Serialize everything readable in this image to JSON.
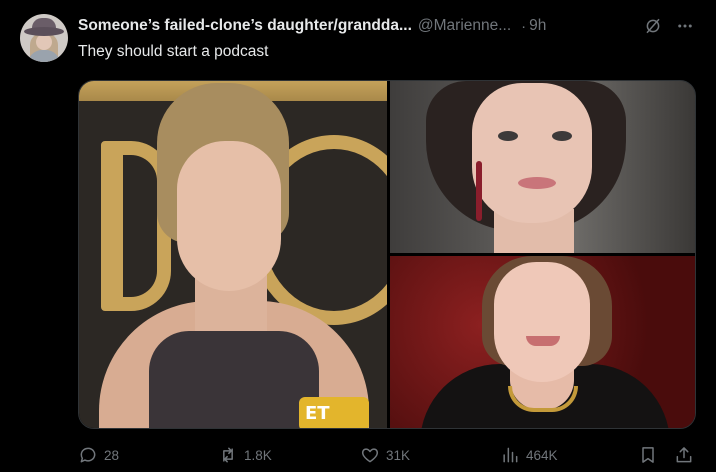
{
  "author": {
    "display_name": "Someone’s failed-clone’s daughter/grandda...",
    "handle": "@Marienne...",
    "separator": "·",
    "time": "9h"
  },
  "post": {
    "text": "They should start a podcast"
  },
  "media": {
    "photos": [
      {
        "label": "ET"
      }
    ]
  },
  "actions": {
    "replies": "28",
    "reposts": "1.8K",
    "likes": "31K",
    "views": "464K"
  },
  "icons": {
    "grok": "grok-icon",
    "more": "more-icon",
    "reply": "reply-icon",
    "repost": "repost-icon",
    "like": "heart-icon",
    "views": "views-icon",
    "bookmark": "bookmark-icon",
    "share": "share-icon"
  },
  "colors": {
    "background": "#000000",
    "text_primary": "#e7e9ea",
    "text_secondary": "#71767b"
  }
}
